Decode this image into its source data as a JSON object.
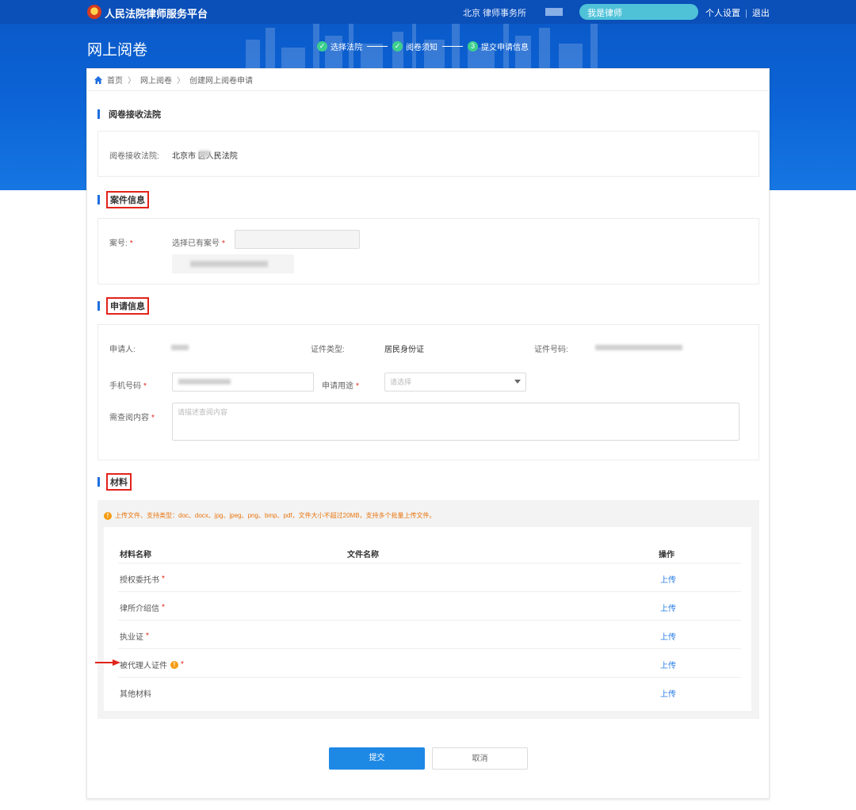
{
  "header": {
    "site_title": "人民法院律师服务平台",
    "firm_name": "北京 律师事务所",
    "role_label": "我是律师",
    "settings_label": "个人设置",
    "separator": "|",
    "logout_label": "退出",
    "page_title": "网上阅卷"
  },
  "steps": [
    {
      "label": "选择法院",
      "marker": "✓"
    },
    {
      "label": "阅卷须知",
      "marker": "✓"
    },
    {
      "label": "提交申请信息",
      "marker": "3"
    }
  ],
  "breadcrumb": {
    "home": "首页",
    "level1": "网上阅卷",
    "level2": "创建网上阅卷申请",
    "separator": "〉"
  },
  "court_section": {
    "title": "阅卷接收法院",
    "field_label": "阅卷接收法院:",
    "value": "北京市 区人民法院"
  },
  "case_section": {
    "title": "案件信息",
    "case_no_label": "案号:",
    "select_label": "选择已有案号",
    "required_mark": "*"
  },
  "apply_section": {
    "title": "申请信息",
    "applicant_label": "申请人:",
    "id_type_label": "证件类型:",
    "id_type_value": "居民身份证",
    "id_no_label": "证件号码:",
    "phone_label": "手机号码",
    "purpose_label": "申请用途",
    "purpose_placeholder": "请选择",
    "content_label": "需查阅内容",
    "content_placeholder": "请描述查阅内容",
    "required_mark": "*"
  },
  "materials_section": {
    "title": "材料",
    "notice": "上传文件、支持类型：doc、docx、jpg、jpeg、png、bmp、pdf，文件大小不超过20MB，支持多个批量上传文件。",
    "notice_icon": "!",
    "columns": {
      "name": "材料名称",
      "file": "文件名称",
      "action": "操作"
    },
    "rows": [
      {
        "name": "授权委托书",
        "required": "*",
        "action": "上传"
      },
      {
        "name": "律所介绍信",
        "required": "*",
        "action": "上传"
      },
      {
        "name": "执业证",
        "required": "*",
        "action": "上传"
      },
      {
        "name": "被代理人证件",
        "required": "*",
        "action": "上传",
        "info_icon": "!"
      },
      {
        "name": "其他材料",
        "required": "",
        "action": "上传"
      }
    ]
  },
  "buttons": {
    "submit": "提交",
    "cancel": "取消"
  },
  "colors": {
    "primary": "#1e88e5",
    "header_blue": "#0c64d6",
    "highlight_red": "#e2231a",
    "warning_orange": "#e8750e"
  }
}
